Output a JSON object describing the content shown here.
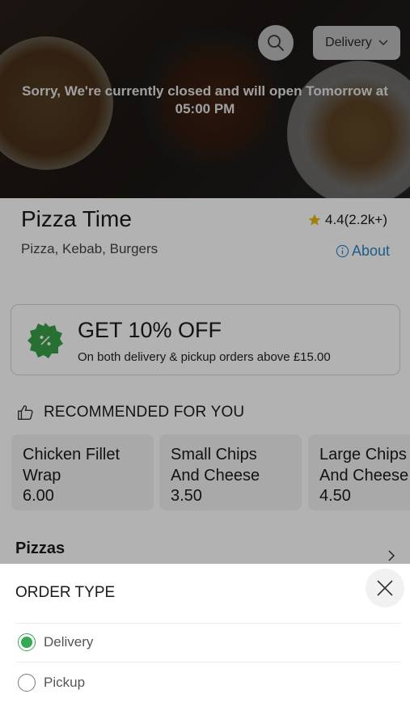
{
  "hero": {
    "closed_message_line1": "Sorry, We're currently closed and will open Tomorrow at",
    "closed_message_line2": "05:00 PM",
    "search_icon": "search-icon",
    "order_type_selected": "Delivery"
  },
  "restaurant": {
    "name": "Pizza Time",
    "rating": "4.4(2.2k+)",
    "cuisines": "Pizza, Kebab, Burgers",
    "about_label": "About"
  },
  "offer": {
    "title": "GET 10% OFF",
    "subtitle": "On both delivery & pickup orders above £15.00"
  },
  "recommended": {
    "heading": "RECOMMENDED FOR YOU",
    "items": [
      {
        "name_line1": "Chicken Fillet",
        "name_line2": "Wrap",
        "price": "6.00"
      },
      {
        "name_line1": "Small Chips",
        "name_line2": "And Cheese",
        "price": "3.50"
      },
      {
        "name_line1": "Large Chips",
        "name_line2": "And Cheese",
        "price": "4.50"
      }
    ]
  },
  "menu": {
    "section_title": "Pizzas"
  },
  "order_sheet": {
    "title": "ORDER TYPE",
    "options": [
      {
        "label": "Delivery",
        "selected": true
      },
      {
        "label": "Pickup",
        "selected": false
      }
    ]
  },
  "colors": {
    "accent_green": "#34a853",
    "link_blue": "#2a86c8",
    "star_gold": "#e8b90f",
    "offer_green": "#3aa04a"
  }
}
